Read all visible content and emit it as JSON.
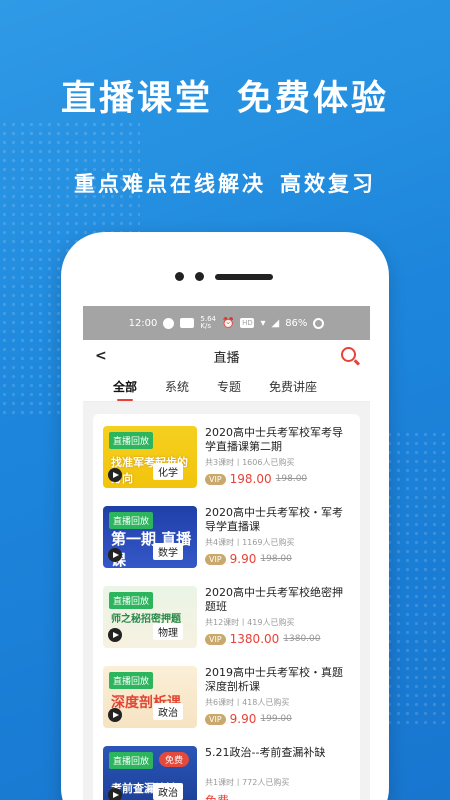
{
  "promo": {
    "headline_left": "直播课堂",
    "headline_right": "免费体验",
    "subline_left": "重点难点在线解决",
    "subline_right": "高效复习"
  },
  "statusbar": {
    "time": "12:00",
    "speed_value": "5.64",
    "speed_unit": "K/s",
    "hd": "HD",
    "battery": "86%"
  },
  "navbar": {
    "title": "直播"
  },
  "tabs": [
    "全部",
    "系统",
    "专题",
    "免费讲座"
  ],
  "courses": [
    {
      "title": "2020高中士兵考军校军考导学直播课第二期",
      "meta": "共3课时丨1606人已购买",
      "vip": "VIP",
      "price": "198.00",
      "orig": "198.00",
      "thumb_tag": "直播回放",
      "thumb_main": "找准军考起步的方向",
      "thumb_subject": "化学"
    },
    {
      "title": "2020高中士兵考军校・军考导学直播课",
      "meta": "共4课时丨1169人已购买",
      "vip": "VIP",
      "price": "9.90",
      "orig": "198.00",
      "thumb_tag": "直播回放",
      "thumb_main": "第一期 直播课",
      "thumb_subject": "数学"
    },
    {
      "title": "2020高中士兵考军校绝密押题班",
      "meta": "共12课时丨419人已购买",
      "vip": "VIP",
      "price": "1380.00",
      "orig": "1380.00",
      "thumb_tag": "直播回放",
      "thumb_main": "师之秘招密押题",
      "thumb_subject": "物理"
    },
    {
      "title": "2019高中士兵考军校・真题深度剖析课",
      "meta": "共6课时丨418人已购买",
      "vip": "VIP",
      "price": "9.90",
      "orig": "199.00",
      "thumb_tag": "直播回放",
      "thumb_main": "深度剖析课",
      "thumb_subject": "政治"
    },
    {
      "title": "5.21政治--考前查漏补缺",
      "meta": "共1课时丨772人已购买",
      "free": "免费",
      "thumb_tag": "直播回放",
      "thumb_tag2": "免费",
      "thumb_main": "考前查漏补缺",
      "thumb_subject": "政治"
    }
  ]
}
